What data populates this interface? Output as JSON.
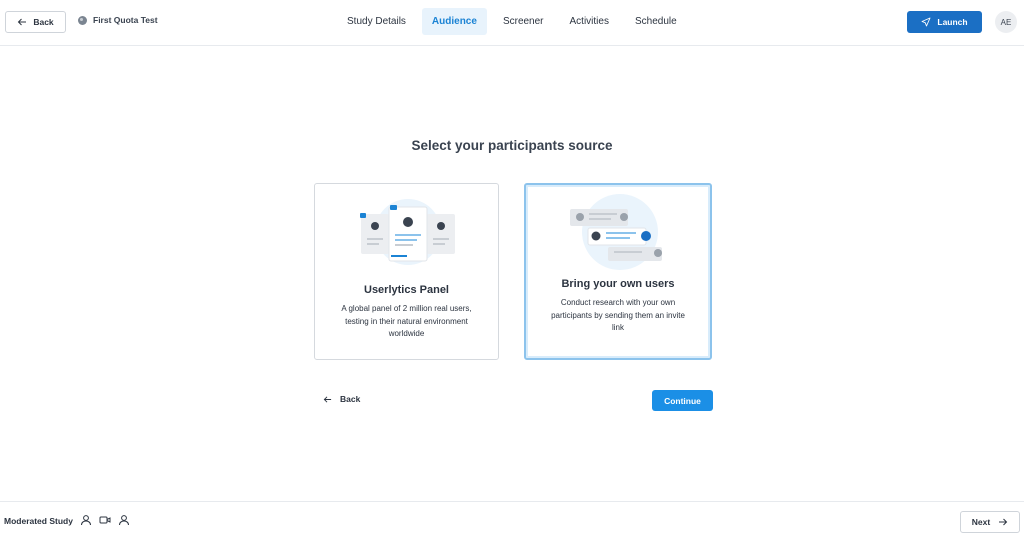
{
  "header": {
    "back_label": "Back",
    "study_title": "First Quota Test",
    "tabs": [
      {
        "label": "Study Details"
      },
      {
        "label": "Audience"
      },
      {
        "label": "Screener"
      },
      {
        "label": "Activities"
      },
      {
        "label": "Schedule"
      }
    ],
    "active_tab": "Audience",
    "launch_label": "Launch",
    "avatar_initials": "AE"
  },
  "main": {
    "heading": "Select your participants source",
    "options": [
      {
        "title": "Userlytics Panel",
        "description": "A global panel of 2 million real users, testing in their natural environment worldwide",
        "selected": false
      },
      {
        "title": "Bring your own users",
        "description": "Conduct research with your own participants by sending them an invite link",
        "selected": true
      }
    ],
    "back_label": "Back",
    "continue_label": "Continue"
  },
  "footer": {
    "study_type": "Moderated Study",
    "icons": [
      "user-icon",
      "video-camera-icon",
      "user-icon"
    ],
    "next_label": "Next"
  },
  "colors": {
    "primary": "#1b8fe6",
    "launch": "#1b6fc4",
    "active_tab_bg": "#e8f3fc",
    "selected_border": "#8cc3ec",
    "text": "#2c3440"
  }
}
